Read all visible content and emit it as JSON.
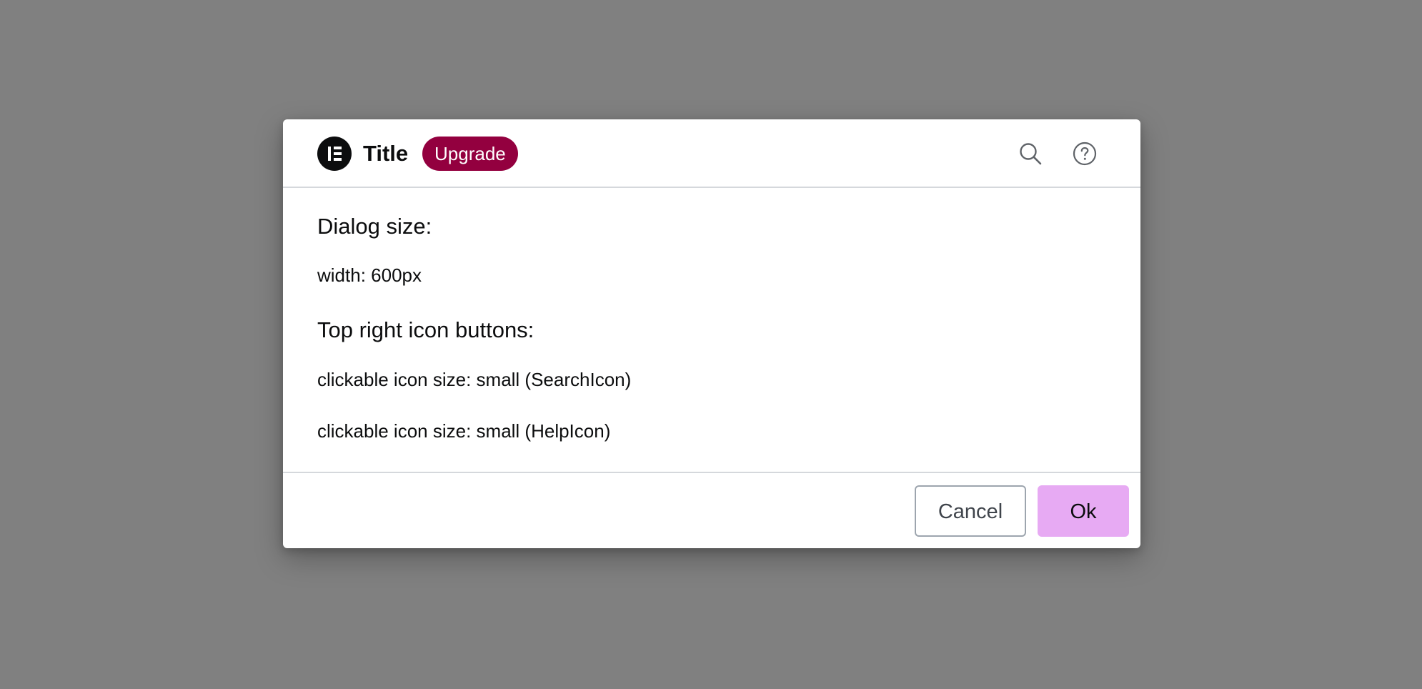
{
  "colors": {
    "backdrop": "#808080",
    "upgrade_badge_bg": "#93003f",
    "ok_button_bg": "#e7aaf3",
    "logo_bg": "#0c0d0e"
  },
  "header": {
    "logo_icon": "elementor-logo-icon",
    "title": "Title",
    "badge_label": "Upgrade",
    "actions": [
      {
        "icon": "search-icon"
      },
      {
        "icon": "help-icon"
      }
    ]
  },
  "body": {
    "heading_1": "Dialog size:",
    "text_1": "width: 600px",
    "heading_2": "Top right icon buttons:",
    "text_2": "clickable icon size: small (SearchIcon)",
    "text_3": "clickable icon size: small (HelpIcon)"
  },
  "footer": {
    "cancel_label": "Cancel",
    "ok_label": "Ok"
  }
}
